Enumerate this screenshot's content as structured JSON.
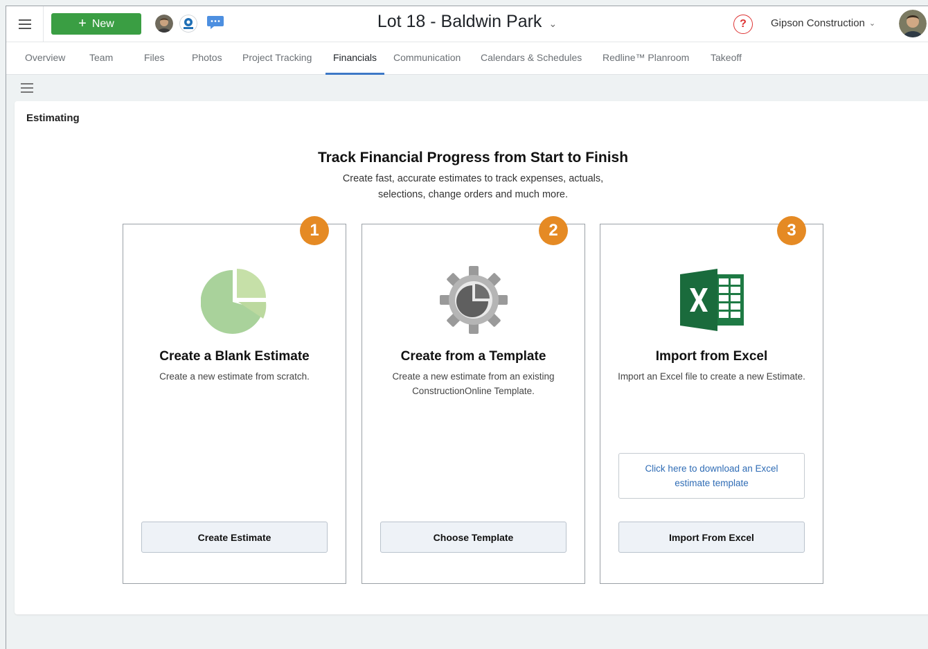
{
  "header": {
    "new_label": "New",
    "project_title": "Lot 18 - Baldwin Park",
    "help_label": "?",
    "company_name": "Gipson Construction",
    "accent_green": "#3a9e43",
    "accent_blue": "#3d78c7"
  },
  "tabs": [
    {
      "label": "Overview",
      "active": false
    },
    {
      "label": "Team",
      "active": false
    },
    {
      "label": "Files",
      "active": false
    },
    {
      "label": "Photos",
      "active": false
    },
    {
      "label": "Project Tracking",
      "active": false
    },
    {
      "label": "Financials",
      "active": true
    },
    {
      "label": "Communication",
      "active": false
    },
    {
      "label": "Calendars & Schedules",
      "active": false
    },
    {
      "label": "Redline™ Planroom",
      "active": false
    },
    {
      "label": "Takeoff",
      "active": false
    }
  ],
  "panel": {
    "title": "Estimating",
    "hero_title": "Track Financial Progress from Start to Finish",
    "hero_sub_line1": "Create fast, accurate estimates to track expenses, actuals,",
    "hero_sub_line2": "selections, change orders and much more."
  },
  "cards": [
    {
      "badge": "1",
      "icon": "pie-chart-icon",
      "title": "Create a Blank Estimate",
      "desc": "Create a new estimate from scratch.",
      "button": "Create Estimate"
    },
    {
      "badge": "2",
      "icon": "gear-chart-icon",
      "title": "Create from a Template",
      "desc": "Create a new estimate from an existing ConstructionOnline Template.",
      "button": "Choose Template"
    },
    {
      "badge": "3",
      "icon": "excel-icon",
      "title": "Import from Excel",
      "desc": "Import an Excel file to create a new Estimate.",
      "download_link": "Click here to download an Excel estimate template",
      "button": "Import From Excel"
    }
  ],
  "badge_color": "#e58a24"
}
